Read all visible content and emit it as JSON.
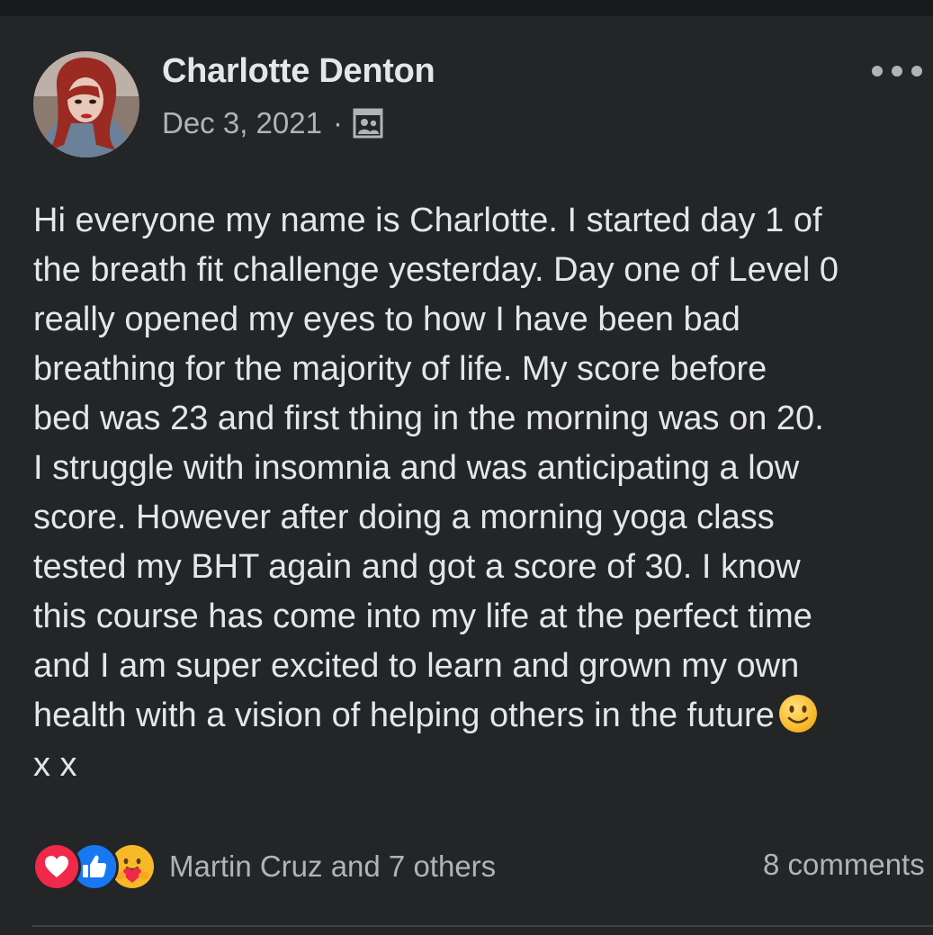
{
  "post": {
    "author": "Charlotte Denton",
    "date": "Dec 3, 2021",
    "separator": "·",
    "audience_icon": "members-icon",
    "more_icon": "more-dots-icon",
    "text_lines": [
      "Hi everyone my name is Charlotte. I started day 1 of",
      "the breath fit challenge yesterday. Day one of Level 0",
      "really opened my eyes to how I have been bad",
      "breathing for the majority of life. My score before",
      "bed was 23 and first thing in the morning was on 20.",
      "I struggle with insomnia and was anticipating a low",
      "score. However after doing a morning yoga class",
      "tested my BHT again and got a score of 30. I know",
      "this course has come into my life at the perfect time",
      "and I am super excited to learn and grown my own",
      "health with a vision of helping others in the future",
      "x x"
    ],
    "emoji": "slightly-smiling-face-icon"
  },
  "reactions": {
    "icons": [
      "love-reaction-icon",
      "like-reaction-icon",
      "care-reaction-icon"
    ],
    "summary": "Martin Cruz and 7 others",
    "comments": "8 comments"
  },
  "colors": {
    "background": "#242526",
    "text_primary": "#e4e6eb",
    "text_secondary": "#b0b3b8",
    "like_blue": "#1877f2",
    "love_red": "#f02849",
    "care_yellow": "#f7b928"
  }
}
